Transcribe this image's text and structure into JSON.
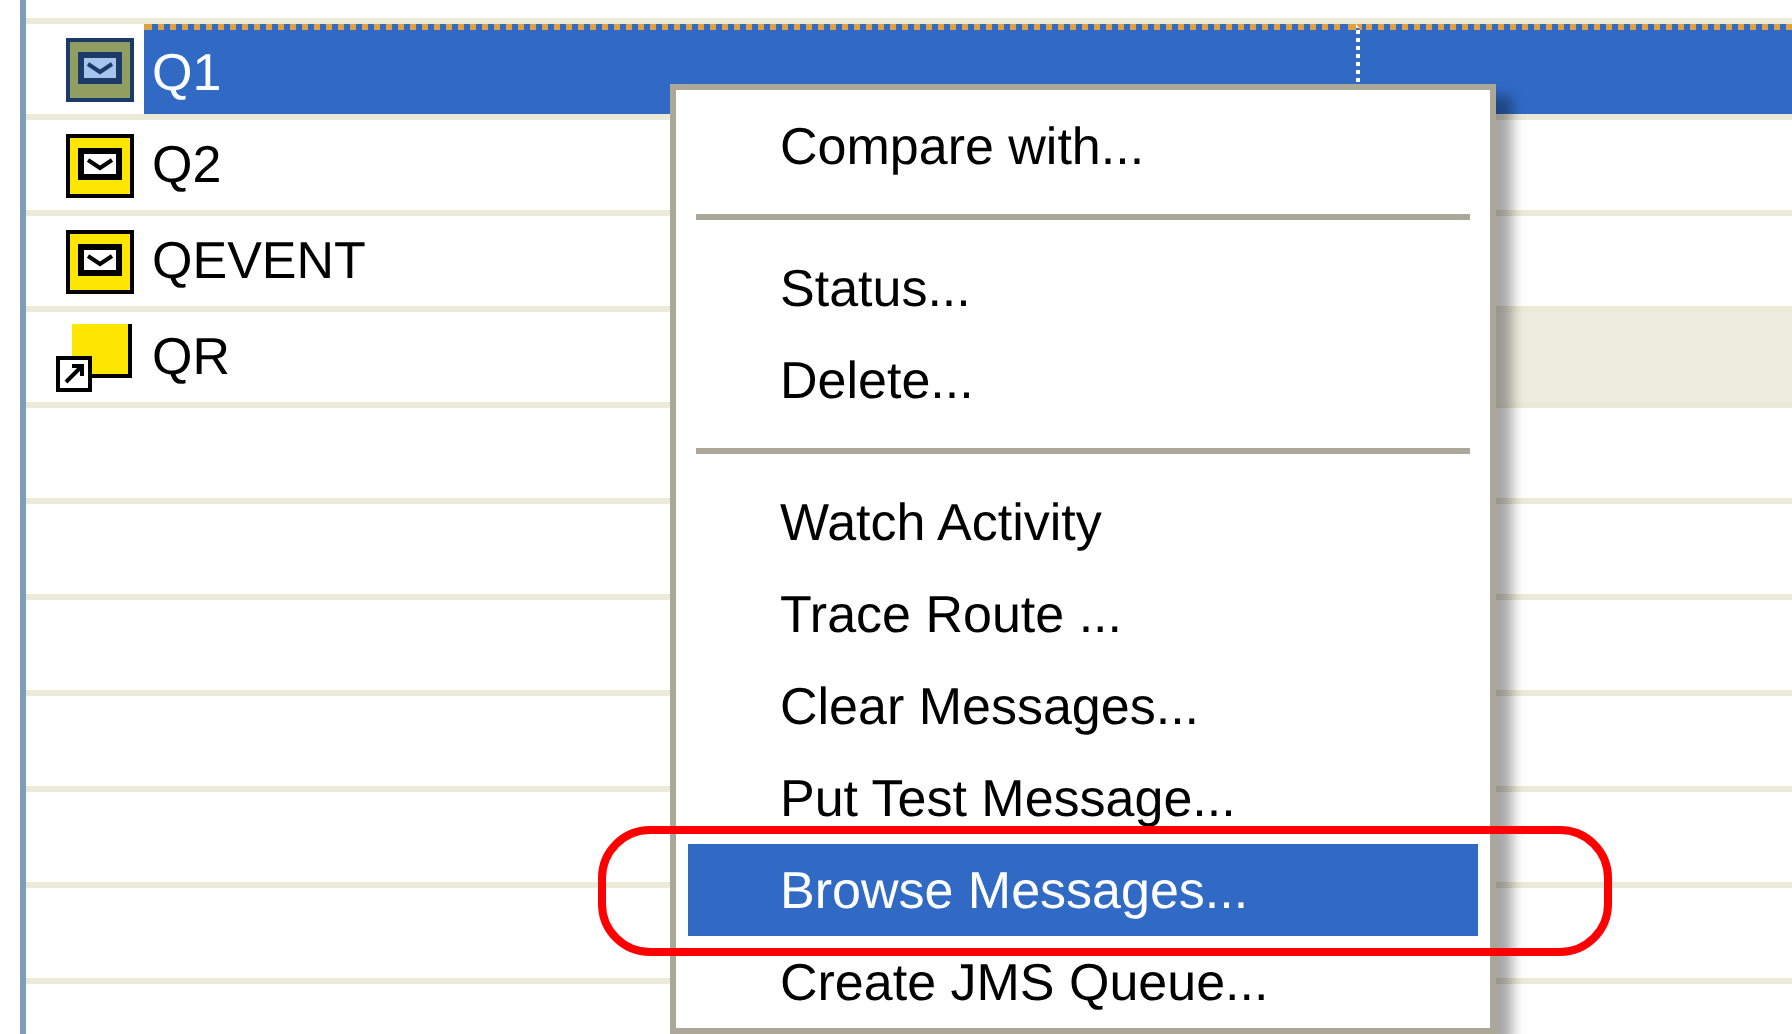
{
  "queue_list": {
    "rows": [
      {
        "kind": "queue",
        "name": "Q1",
        "selected": true
      },
      {
        "kind": "queue",
        "name": "Q2",
        "selected": false,
        "shaded": false
      },
      {
        "kind": "queue",
        "name": "QEVENT",
        "selected": false,
        "shaded": false
      },
      {
        "kind": "remote-queue",
        "name": "QR",
        "selected": false,
        "shaded": true
      }
    ]
  },
  "context_menu": {
    "items": [
      {
        "kind": "item",
        "label": "Compare with...",
        "selected": false
      },
      {
        "kind": "separator"
      },
      {
        "kind": "item",
        "label": "Status...",
        "selected": false
      },
      {
        "kind": "item",
        "label": "Delete...",
        "selected": false
      },
      {
        "kind": "separator"
      },
      {
        "kind": "item",
        "label": "Watch Activity",
        "selected": false
      },
      {
        "kind": "item",
        "label": "Trace Route ...",
        "selected": false
      },
      {
        "kind": "item",
        "label": "Clear Messages...",
        "selected": false
      },
      {
        "kind": "item",
        "label": "Put Test Message...",
        "selected": false
      },
      {
        "kind": "item",
        "label": "Browse Messages...",
        "selected": true
      },
      {
        "kind": "item",
        "label": "Create JMS Queue...",
        "selected": false
      }
    ]
  }
}
